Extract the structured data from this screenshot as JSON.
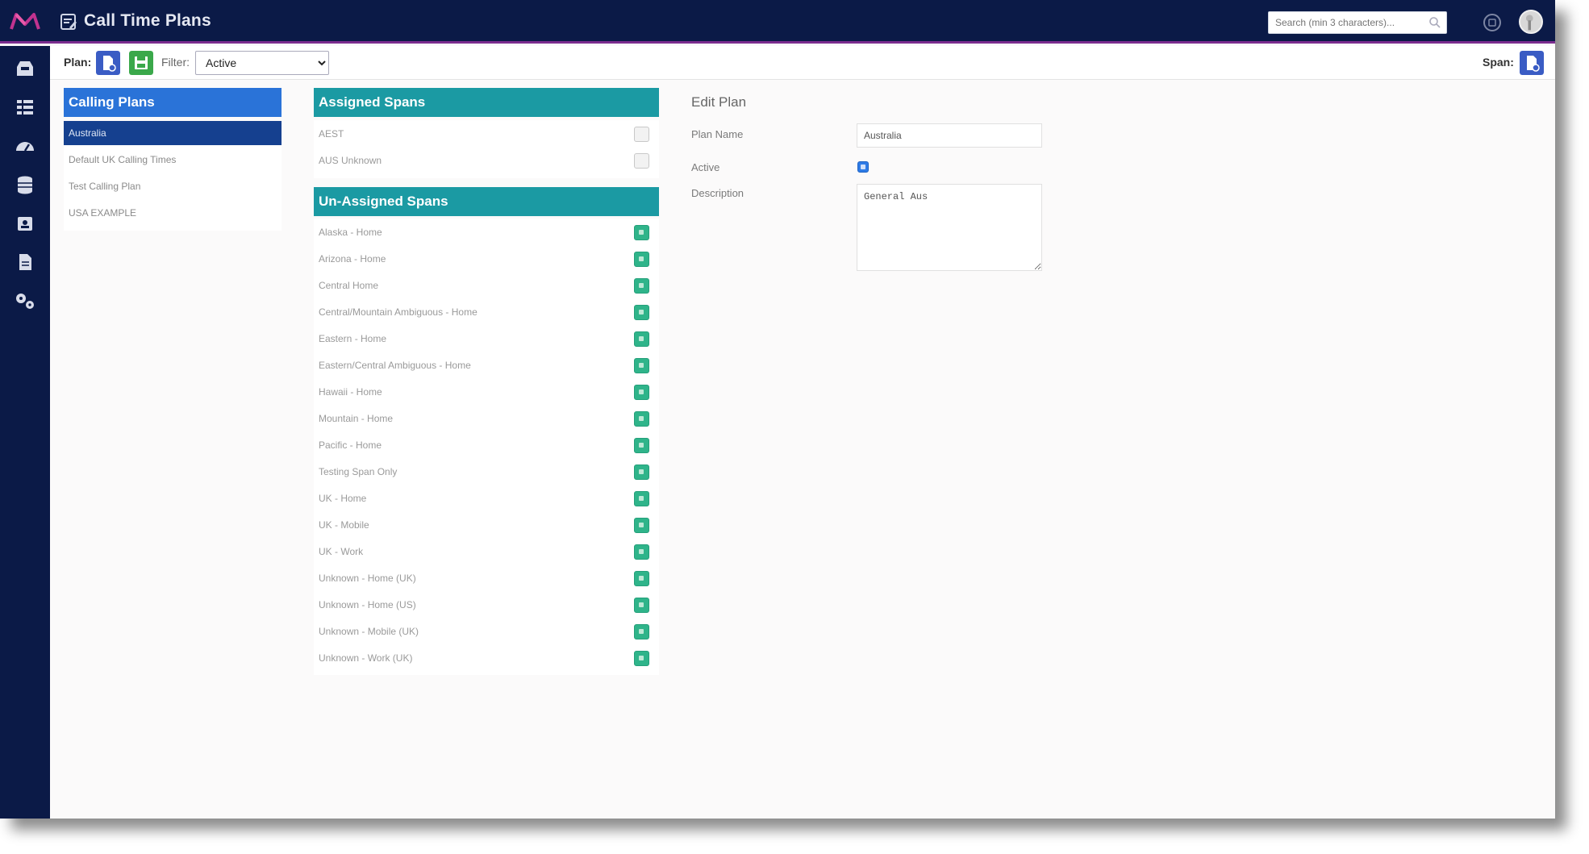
{
  "header": {
    "title": "Call Time Plans",
    "search_placeholder": "Search (min 3 characters)...",
    "brand_icon": "brand-logo-icon",
    "colors": {
      "header_bg": "#0b1a47",
      "accent": "#7b2d8f"
    }
  },
  "sidebar": {
    "items": [
      {
        "name": "dashboard",
        "icon": "inbox-icon"
      },
      {
        "name": "lists",
        "icon": "grid-icon"
      },
      {
        "name": "speed",
        "icon": "gauge-icon"
      },
      {
        "name": "database",
        "icon": "database-icon"
      },
      {
        "name": "contacts",
        "icon": "id-card-icon"
      },
      {
        "name": "reports",
        "icon": "document-icon"
      },
      {
        "name": "settings",
        "icon": "gears-icon"
      }
    ]
  },
  "toolbar": {
    "plan_label": "Plan:",
    "filter_label": "Filter:",
    "filter_value": "Active",
    "span_label": "Span:"
  },
  "calling_plans": {
    "title": "Calling Plans",
    "items": [
      "Australia",
      "Default UK Calling Times",
      "Test Calling Plan",
      "USA EXAMPLE"
    ],
    "selected_index": 0,
    "colors": {
      "header": "#2a73d8",
      "selected": "#15408f"
    }
  },
  "assigned_spans": {
    "title": "Assigned Spans",
    "items": [
      "AEST",
      "AUS Unknown"
    ]
  },
  "unassigned_spans": {
    "title": "Un-Assigned Spans",
    "items": [
      "Alaska - Home",
      "Arizona - Home",
      "Central Home",
      "Central/Mountain Ambiguous - Home",
      "Eastern - Home",
      "Eastern/Central Ambiguous - Home",
      "Hawaii - Home",
      "Mountain - Home",
      "Pacific - Home",
      "Testing Span Only",
      "UK - Home",
      "UK - Mobile",
      "UK - Work",
      "Unknown - Home (UK)",
      "Unknown - Home (US)",
      "Unknown - Mobile (UK)",
      "Unknown - Work (UK)"
    ],
    "colors": {
      "header": "#1b9aa3",
      "add": "#2fb48a"
    }
  },
  "edit_plan": {
    "title": "Edit Plan",
    "plan_name_label": "Plan Name",
    "plan_name_value": "Australia",
    "active_label": "Active",
    "active_checked": true,
    "description_label": "Description",
    "description_value": "General Aus"
  }
}
